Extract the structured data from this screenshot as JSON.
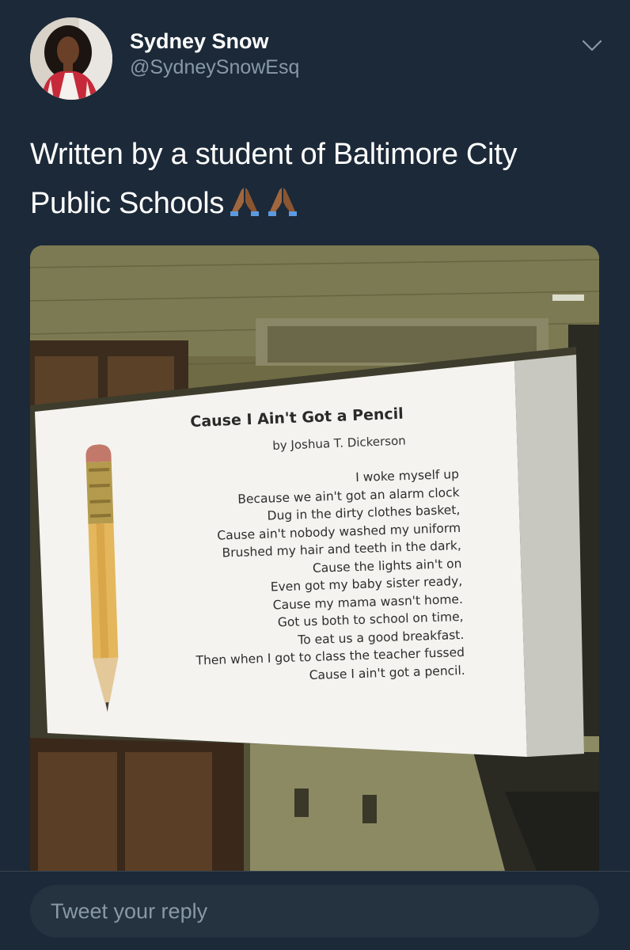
{
  "tweet": {
    "display_name": "Sydney Snow",
    "handle": "@SydneySnowEsq",
    "text": "Written by a student of Baltimore City Public Schools",
    "emoji": [
      "folded-hands-emoji",
      "folded-hands-emoji"
    ],
    "caret_icon": "chevron-down-icon"
  },
  "media": {
    "poem": {
      "title": "Cause I Ain't Got a Pencil",
      "author": "by Joshua T. Dickerson",
      "lines": [
        "I woke myself up",
        "Because we ain't got an alarm clock",
        "Dug in the dirty clothes basket,",
        "Cause ain't nobody washed my uniform",
        "Brushed my hair and teeth in the dark,",
        "Cause the lights ain't on",
        "Even got my baby sister ready,",
        "Cause my mama wasn't home.",
        "Got us both to school on time,",
        "To eat us a good breakfast.",
        "Then when I got to class the teacher fussed",
        "Cause I ain't got a pencil."
      ]
    }
  },
  "reply": {
    "placeholder": "Tweet your reply"
  },
  "colors": {
    "background": "#1c2938",
    "secondary_text": "#8899a6",
    "reply_field": "#253341",
    "emoji_skin": "#a0673f"
  }
}
